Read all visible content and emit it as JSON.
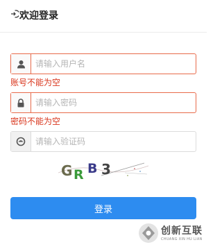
{
  "header": {
    "title": "欢迎登录",
    "icon": "login-icon"
  },
  "form": {
    "username": {
      "placeholder": "请输入用户名",
      "value": "",
      "icon": "user-icon",
      "error": "账号不能为空"
    },
    "password": {
      "placeholder": "请输入密码",
      "value": "",
      "icon": "lock-icon",
      "error": "密码不能为空"
    },
    "captcha": {
      "placeholder": "请输入验证码",
      "value": "",
      "icon": "captcha-icon",
      "image_text": "GRB3"
    },
    "submit_label": "登录"
  },
  "watermark": {
    "title": "创新互联",
    "subtitle": "CHUANG XIN HU LIAN"
  },
  "colors": {
    "error": "#d9351c",
    "error_border": "#e86a4a",
    "primary": "#2d8cf0"
  }
}
